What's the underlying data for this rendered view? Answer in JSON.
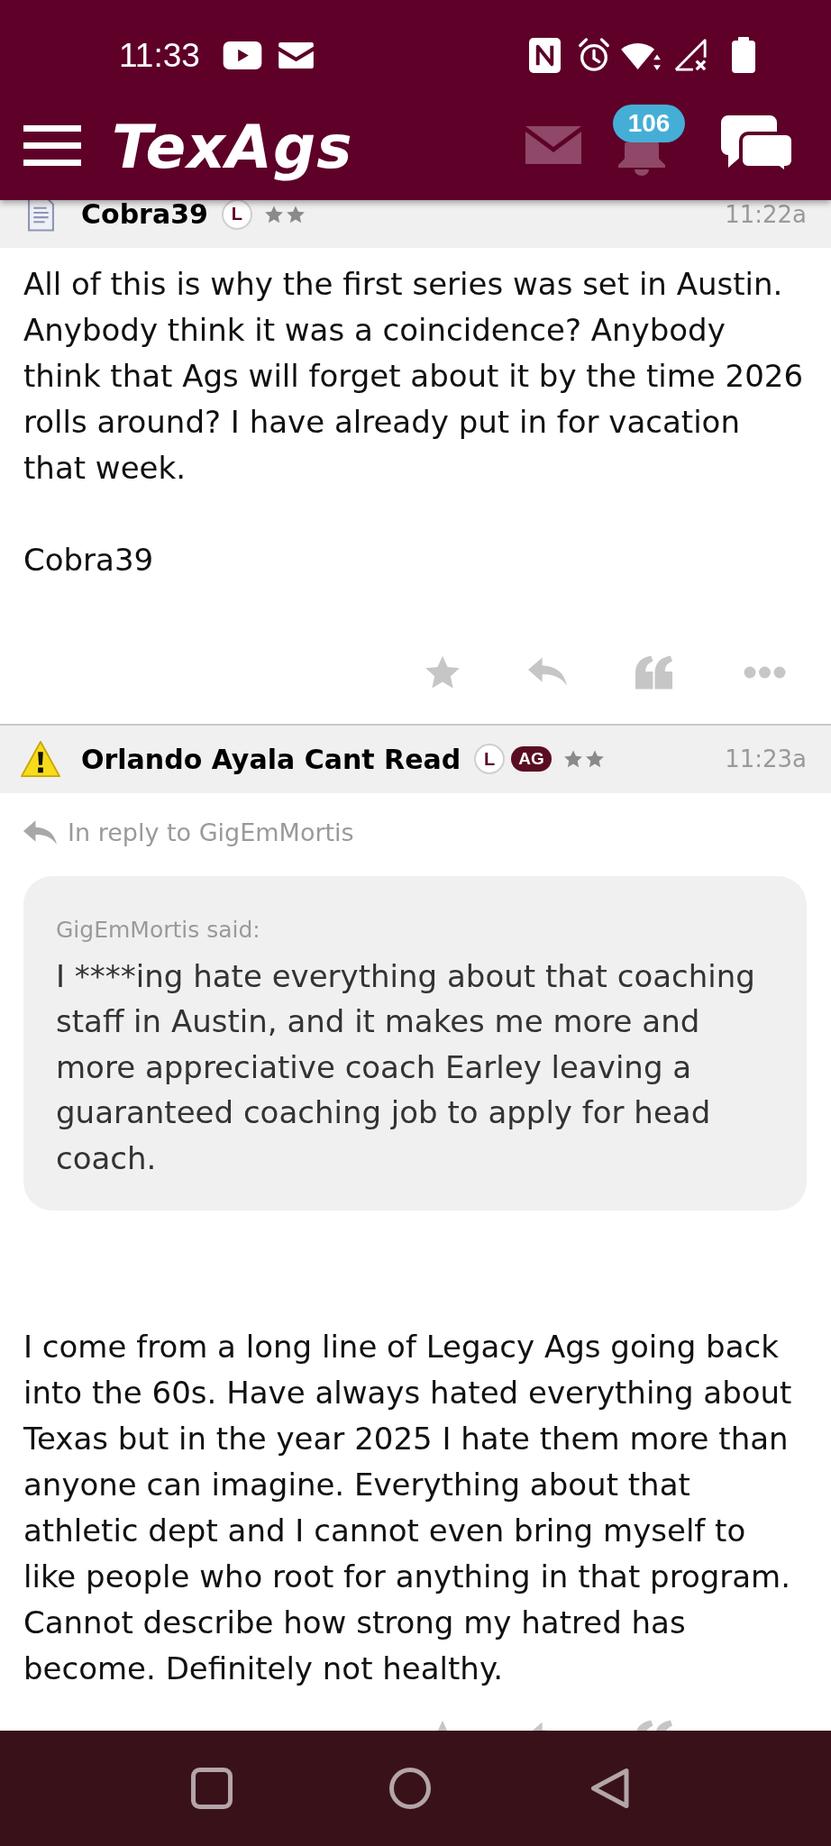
{
  "status_bar": {
    "time": "11:33"
  },
  "app_bar": {
    "logo": "TexAgs",
    "notification_count": "106"
  },
  "posts": [
    {
      "avatar": {
        "kind": "document"
      },
      "author": "Cobra39",
      "badges": [
        {
          "kind": "circle",
          "label": "L"
        },
        {
          "kind": "star"
        },
        {
          "kind": "star"
        }
      ],
      "time": "11:22a",
      "paragraphs": [
        "All of this is why the first series was set in Austin. Anybody think it was a coincidence? Anybody think that Ags will forget about it by the time 2026 rolls around? I have already put in for vacation that week."
      ],
      "signature": "Cobra39"
    },
    {
      "avatar": {
        "kind": "warning"
      },
      "author": "Orlando Ayala Cant Read",
      "badges": [
        {
          "kind": "circle",
          "label": "L"
        },
        {
          "kind": "pill",
          "label": "AG"
        },
        {
          "kind": "star"
        },
        {
          "kind": "star"
        }
      ],
      "time": "11:23a",
      "reply_to": "In reply to GigEmMortis",
      "quote": {
        "attribution": "GigEmMortis said:",
        "text": "I ****ing hate everything about that coaching staff in Austin, and it makes me more and more appreciative coach Earley leaving a guaranteed coaching job to apply for head coach."
      },
      "paragraphs": [
        "I come from a long line of Legacy Ags going back into the 60s. Have always hated everything about Texas but in the year 2025 I hate them more than anyone can imagine. Everything about that athletic dept and I cannot even bring myself to like people who root for anything in that program. Cannot describe how strong my hatred has become. Definitely not healthy."
      ]
    }
  ]
}
